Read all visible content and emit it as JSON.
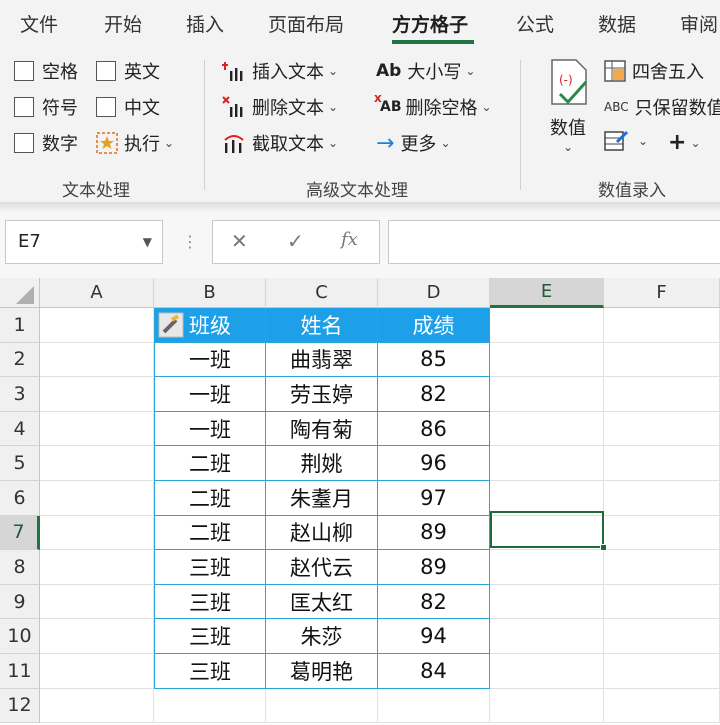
{
  "menu": {
    "tabs": [
      "文件",
      "开始",
      "插入",
      "页面布局",
      "方方格子",
      "公式",
      "数据",
      "审阅"
    ],
    "active": "方方格子"
  },
  "ribbon": {
    "text_group": {
      "checkboxes": [
        "空格",
        "英文",
        "符号",
        "中文",
        "数字"
      ],
      "execute_label": "执行",
      "group_label": "文本处理"
    },
    "advanced_group": {
      "insert_text": "插入文本",
      "delete_text": "删除文本",
      "extract_text": "截取文本",
      "case_label": "大小写",
      "case_icon_text": "Ab",
      "delete_spaces": "删除空格",
      "delete_spaces_icon_text": "AB",
      "more_label": "更多",
      "group_label": "高级文本处理"
    },
    "number_group": {
      "numeric_label": "数值",
      "round_label": "四舍五入",
      "keep_label": "只保留数值",
      "keep_icon_text": "ABC",
      "group_label": "数值录入"
    }
  },
  "formula_bar": {
    "name_box": "E7",
    "cancel_symbol": "✕",
    "confirm_symbol": "✓",
    "fx_symbol": "fx",
    "formula": ""
  },
  "grid": {
    "columns": [
      "A",
      "B",
      "C",
      "D",
      "E",
      "F"
    ],
    "rows": [
      "1",
      "2",
      "3",
      "4",
      "5",
      "6",
      "7",
      "8",
      "9",
      "10",
      "11",
      "12"
    ],
    "selected_cell": "E7",
    "table": {
      "headers": [
        "班级",
        "姓名",
        "成绩"
      ],
      "rows": [
        [
          "一班",
          "曲翡翠",
          "85"
        ],
        [
          "一班",
          "劳玉婷",
          "82"
        ],
        [
          "一班",
          "陶有菊",
          "86"
        ],
        [
          "二班",
          "荆姚",
          "96"
        ],
        [
          "二班",
          "朱耋月",
          "97"
        ],
        [
          "二班",
          "赵山柳",
          "89"
        ],
        [
          "三班",
          "赵代云",
          "89"
        ],
        [
          "三班",
          "匡太红",
          "82"
        ],
        [
          "三班",
          "朱莎",
          "94"
        ],
        [
          "三班",
          "葛明艳",
          "84"
        ]
      ]
    }
  },
  "colors": {
    "accent_green": "#217346",
    "table_header": "#1ea0e8",
    "table_border": "#29a6d8"
  }
}
